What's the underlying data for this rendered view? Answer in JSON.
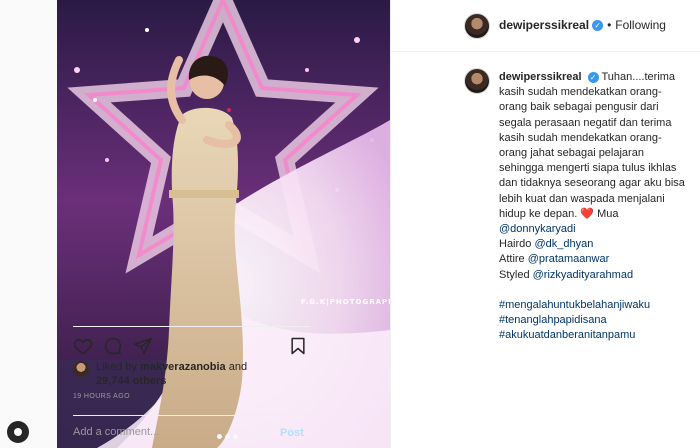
{
  "post": {
    "username": "dewiperssikreal",
    "separator": "•",
    "follow_status": "Following",
    "verified_mark": "✓",
    "photo_watermark": "F.G.K|PHOTOGRAPHY"
  },
  "caption": {
    "username": "dewiperssikreal",
    "lines": [
      "Tuhan....terima",
      "kasih sudah mendekatkan orang-",
      "orang baik sebagai pengusir dari",
      "segala perasaan negatif dan terima",
      "kasih sudah mendekatkan orang-",
      "orang jahat sebagai pelajaran",
      "sehingga mengerti siapa tulus ikhlas",
      "dan tidaknya seseorang agar aku bisa",
      "lebih kuat dan waspada menjalani",
      "hidup ke depan."
    ],
    "heart": "❤️",
    "mua_label": "Mua",
    "mua_handle": "@donnykaryadi",
    "hairdo_label": "Hairdo",
    "hairdo_handle": "@dk_dhyan",
    "attire_label": "Attire",
    "attire_handle": "@pratamaanwar",
    "styled_label": "Styled",
    "styled_handle": "@rizkyadityarahmad",
    "hashtags": [
      "#mengalahuntukbelahanjiwaku",
      "#tenanglahpapidisana",
      "#akukuatdanberanitanpamu"
    ]
  },
  "likes": {
    "prefix": "Liked by",
    "liker": "makverazanobia",
    "and": "and",
    "others": "29,744 others"
  },
  "timestamp": "19 HOURS AGO",
  "comment": {
    "placeholder": "Add a comment...",
    "post_label": "Post"
  },
  "icons": {
    "like": "heart-outline-icon",
    "comment": "speech-bubble-icon",
    "share": "paper-plane-icon",
    "save": "bookmark-icon",
    "next": "chevron-right-icon"
  },
  "colors": {
    "link": "#003569",
    "verified": "#3897f0",
    "post_button_disabled": "#b2dffc",
    "muted_text": "#999999",
    "heart": "#ed4956"
  }
}
